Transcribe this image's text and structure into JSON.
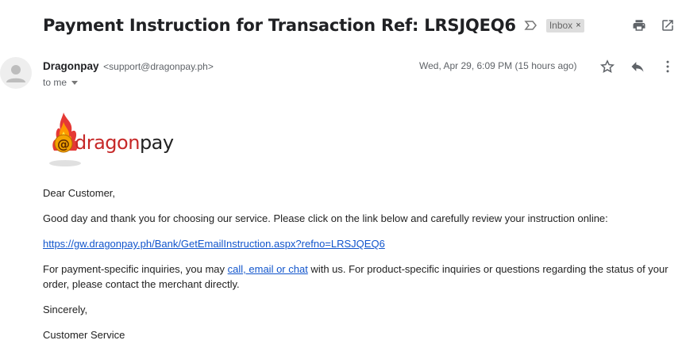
{
  "subject": {
    "title": "Payment Instruction for Transaction Ref: LRSJQEQ6",
    "label": "Inbox",
    "label_close": "×"
  },
  "top_actions": [
    {
      "icon": "print-icon"
    },
    {
      "icon": "open-in-new-window-icon"
    }
  ],
  "message": {
    "sender_name": "Dragonpay",
    "sender_email": "<support@dragonpay.ph>",
    "to": "to me",
    "date": "Wed, Apr 29, 6:09 PM (15 hours ago)",
    "actions": [
      {
        "icon": "star-icon"
      },
      {
        "icon": "reply-icon"
      },
      {
        "icon": "more-vert-icon"
      }
    ]
  },
  "logo": {
    "part1": "dragon",
    "part2": "pay",
    "at": "@"
  },
  "body": {
    "greeting": "Dear Customer,",
    "intro": "Good day and thank you for choosing our service. Please click on the link below and carefully review your instruction online:",
    "link": "https://gw.dragonpay.ph/Bank/GetEmailInstruction.aspx?refno=LRSJQEQ6",
    "inquiry_prefix": "For payment-specific inquiries, you may ",
    "inquiry_link": "call, email or chat",
    "inquiry_suffix": " with us. For product-specific inquiries or questions regarding the status of your order, please contact the merchant directly.",
    "closing": "Sincerely,",
    "signature": "Customer Service"
  },
  "colors": {
    "link": "#1155cc",
    "logo_red": "#c62828",
    "label_bg": "#dddddd"
  }
}
